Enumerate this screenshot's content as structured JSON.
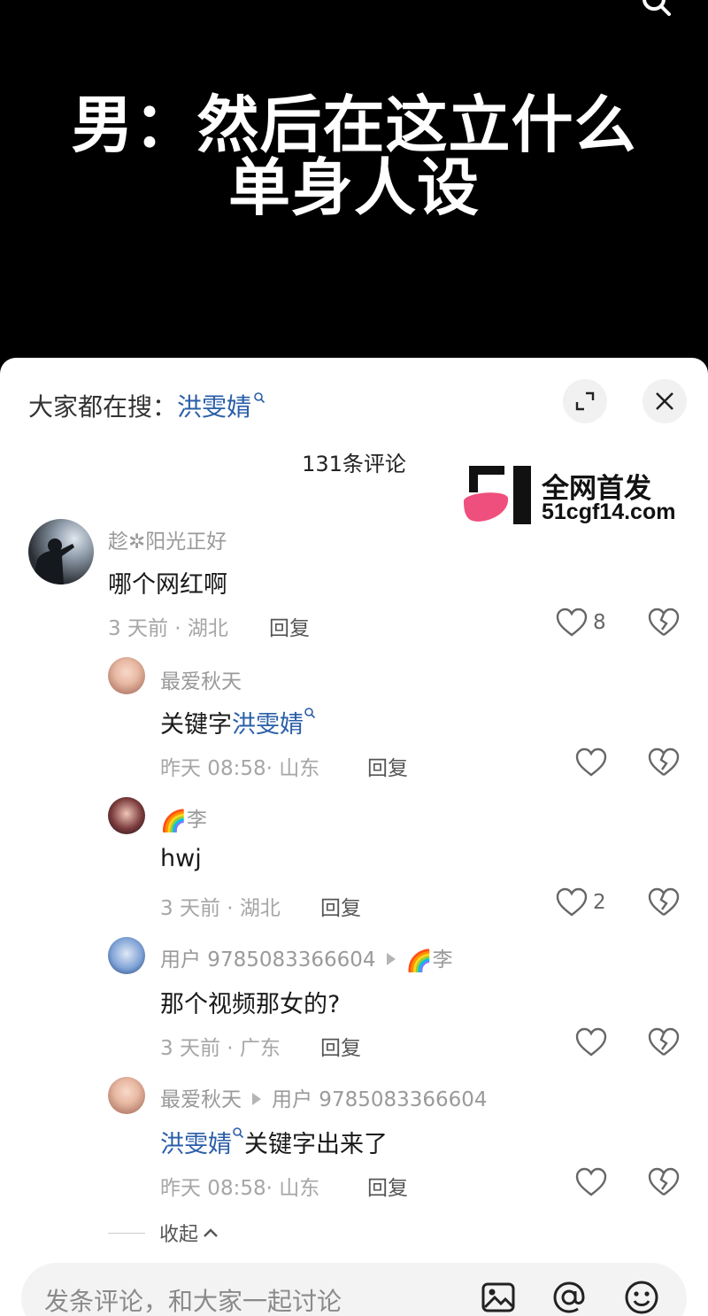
{
  "video": {
    "caption_line1": "男：然后在这立什么",
    "caption_line2": "单身人设"
  },
  "sheet": {
    "search_prefix": "大家都在搜：",
    "search_keyword": "洪雯婧",
    "comment_count": "131条评论"
  },
  "watermark": {
    "line1": "全网首发",
    "line2": "51cgf14.com"
  },
  "comments": [
    {
      "name": "趁✲阳光正好",
      "text": "哪个网红啊",
      "meta": "3 天前 · 湖北",
      "reply": "回复",
      "likes": "8"
    },
    {
      "name": "最爱秋天",
      "text_prefix": "关键字",
      "text_keyword": "洪雯婧",
      "meta": "昨天 08:58· 山东",
      "reply": "回复"
    },
    {
      "name_emoji": "🌈",
      "name": "李",
      "text": "hwj",
      "meta": "3 天前 · 湖北",
      "reply": "回复",
      "likes": "2"
    },
    {
      "name": "用户 9785083366604",
      "reply_to_emoji": "🌈",
      "reply_to": "李",
      "text": "那个视频那女的?",
      "meta": "3 天前 · 广东",
      "reply": "回复"
    },
    {
      "name": "最爱秋天",
      "reply_to": "用户 9785083366604",
      "text_keyword": "洪雯婧",
      "text_suffix": "关键字出来了",
      "meta": "昨天 08:58· 山东",
      "reply": "回复"
    }
  ],
  "collapse_label": "收起",
  "input": {
    "placeholder": "发条评论，和大家一起讨论"
  },
  "colors": {
    "keyword": "#2a5ea8",
    "sheet_bg": "#ffffff",
    "logo_pink": "#ef4f7c"
  },
  "icons": [
    "search-icon",
    "expand-icon",
    "close-icon",
    "heart-icon",
    "broken-heart-icon",
    "image-icon",
    "at-icon",
    "emoji-icon",
    "chevron-up-icon"
  ]
}
